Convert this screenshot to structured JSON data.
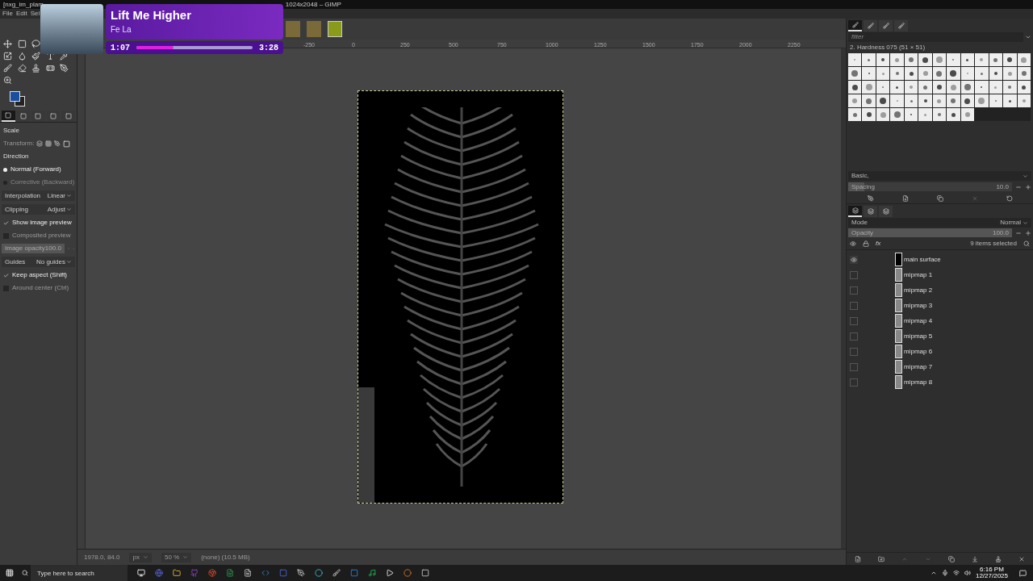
{
  "window": {
    "title": "[nxg_im_plam",
    "title_end": "1024x2048 – GIMP"
  },
  "menu": [
    "File",
    "Edit",
    "Sel"
  ],
  "image_tabs": [
    {
      "selected": false
    },
    {
      "selected": false
    },
    {
      "selected": true
    }
  ],
  "toolbox": {
    "tool_tabs": [
      {
        "selected": true
      },
      {
        "selected": false
      },
      {
        "selected": false
      },
      {
        "selected": false
      },
      {
        "selected": false
      }
    ],
    "options": [
      {
        "kind": "heading",
        "label": "Scale"
      },
      {
        "kind": "transform",
        "label": "Transform:"
      },
      {
        "kind": "heading",
        "label": "Direction"
      },
      {
        "kind": "radio",
        "label": "Normal (Forward)",
        "selected": true
      },
      {
        "kind": "radio",
        "label": "Corrective (Backward)",
        "selected": false
      },
      {
        "kind": "dropdown",
        "label": "Interpolation",
        "value": "Linear"
      },
      {
        "kind": "dropdown",
        "label": "Clipping",
        "value": "Adjust"
      },
      {
        "kind": "checkbox",
        "label": "Show image preview",
        "checked": true
      },
      {
        "kind": "checkbox",
        "label": "Composited preview",
        "checked": false
      },
      {
        "kind": "slider",
        "label": "Image opacity",
        "value": "100.0",
        "level": 1
      },
      {
        "kind": "dropdown",
        "label": "Guides",
        "value": "No guides"
      },
      {
        "kind": "checkbox",
        "label": "Keep aspect (Shift)",
        "checked": true
      },
      {
        "kind": "checkbox",
        "label": "Around center (Ctrl)",
        "checked": false
      }
    ]
  },
  "ruler_labels": [
    "-250",
    "0",
    "250",
    "500",
    "750",
    "1000",
    "1250",
    "1500",
    "1750",
    "2000",
    "2250"
  ],
  "status_bar": {
    "coords": "1978.0, 84.0",
    "unit": "px",
    "zoom": "50 %",
    "info": "(none) (10.5 MB)"
  },
  "brushes": {
    "tabs": [
      {
        "selected": true
      },
      {
        "selected": false
      },
      {
        "selected": false
      },
      {
        "selected": false
      }
    ],
    "filter_placeholder": "filter",
    "current": "2. Hardness 075 (51 × 51)",
    "preset": "Basic,",
    "spacing": {
      "label": "Spacing",
      "value": "10.0",
      "level": 0.1
    }
  },
  "layers": {
    "tabs": [
      {
        "selected": true
      },
      {
        "selected": false
      },
      {
        "selected": false
      }
    ],
    "mode_label": "Mode",
    "mode": "Normal",
    "opacity": {
      "label": "Opacity",
      "value": "100.0",
      "level": 1
    },
    "effects_label": "fx",
    "selection_info": "9 items selected",
    "items": [
      {
        "name": "main surface",
        "visible": true
      },
      {
        "name": "mipmap 1",
        "visible": false
      },
      {
        "name": "mipmap 2",
        "visible": false
      },
      {
        "name": "mipmap 3",
        "visible": false
      },
      {
        "name": "mipmap 4",
        "visible": false
      },
      {
        "name": "mipmap 5",
        "visible": false
      },
      {
        "name": "mipmap 6",
        "visible": false
      },
      {
        "name": "mipmap 7",
        "visible": false
      },
      {
        "name": "mipmap 8",
        "visible": false
      }
    ]
  },
  "now_playing": {
    "title": "Lift Me Higher",
    "artist": "Fe La",
    "elapsed": "1:07",
    "total": "3:28",
    "level": 0.32
  },
  "taskbar": {
    "search_placeholder": "Type here to search",
    "time": "6:16 PM",
    "date": "12/27/2025"
  }
}
